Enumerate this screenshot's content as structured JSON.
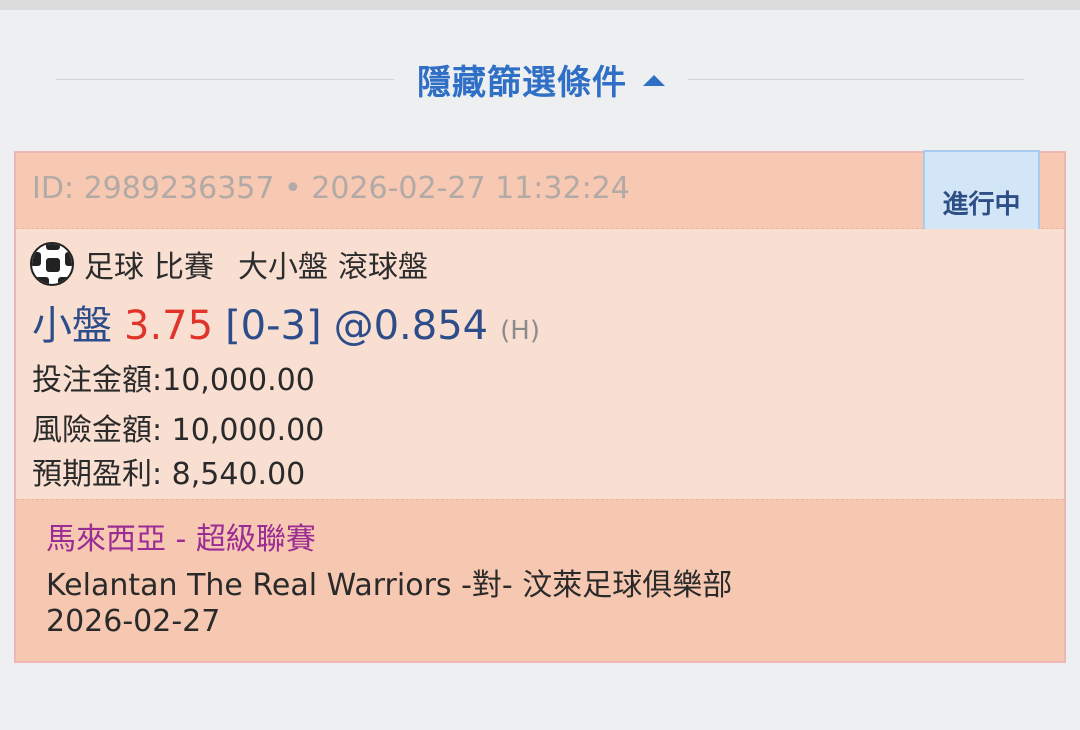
{
  "filter": {
    "label": "隱藏篩選條件",
    "icon": "caret-up-icon",
    "color": "#2f6fc5"
  },
  "bet": {
    "id_text": "ID: 2989236357 • 2026-02-27 11:32:24",
    "status": "進行中",
    "sport_icon": "soccer-ball-icon",
    "sport": "足球",
    "bet_category": "比賽",
    "market": "大小盤",
    "bet_type": "滾球盤",
    "selection": "小盤",
    "line": "3.75",
    "score": "[0-3]",
    "odds": "@0.854",
    "odds_type": "(H)",
    "stake_text": "投注金額:10,000.00",
    "risk_text": "風險金額: 10,000.00",
    "profit_text": "預期盈利: 8,540.00"
  },
  "match": {
    "league": "馬來西亞 - 超級聯賽",
    "teams": "Kelantan The Real Warriors -對- 汶萊足球俱樂部",
    "date": "2026-02-27"
  },
  "colors": {
    "accent": "#2f6fc5",
    "line_red": "#e0342a",
    "league_purple": "#9b2c93",
    "card_header": "#f7c8b2",
    "card_body": "#f9dfd2",
    "status_bg": "#d3e6f7"
  }
}
